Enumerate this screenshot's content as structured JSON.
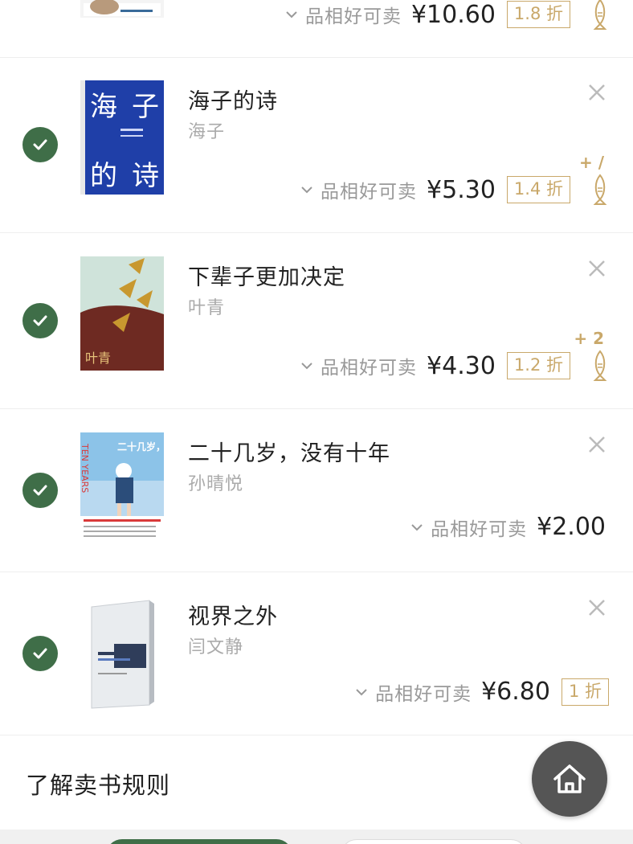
{
  "items": [
    {
      "title": "",
      "author": "",
      "condition": "品相好可卖",
      "price": "¥10.60",
      "discount": "1.8 折",
      "fish_bonus": ""
    },
    {
      "title": "海子的诗",
      "author": "海子",
      "condition": "品相好可卖",
      "price": "¥5.30",
      "discount": "1.4 折",
      "fish_bonus": "+ /"
    },
    {
      "title": "下辈子更加决定",
      "author": "叶青",
      "condition": "品相好可卖",
      "price": "¥4.30",
      "discount": "1.2 折",
      "fish_bonus": "+ 2"
    },
    {
      "title": "二十几岁，没有十年",
      "author": "孙晴悦",
      "condition": "品相好可卖",
      "price": "¥2.00",
      "discount": "",
      "fish_bonus": ""
    },
    {
      "title": "视界之外",
      "author": "闫文静",
      "condition": "品相好可卖",
      "price": "¥6.80",
      "discount": "1 折",
      "fish_bonus": ""
    }
  ],
  "covers": {
    "haizi": {
      "text_1": "海",
      "text_2": "子",
      "text_3": "的",
      "text_4": "诗"
    },
    "yeqing": {
      "author": "叶青"
    },
    "ershi": {
      "title": "二十几岁，没有十年",
      "en": "TEN YEARS"
    }
  },
  "footer": {
    "rules_label": "了解卖书规则"
  },
  "colors": {
    "accent_green": "#3f6e48",
    "gold": "#c9a86a",
    "muted": "#999999"
  },
  "icons": {
    "check": "check-icon",
    "close": "close-icon",
    "chevron": "chevron-down-icon",
    "fish": "fish-icon",
    "home": "home-icon"
  }
}
